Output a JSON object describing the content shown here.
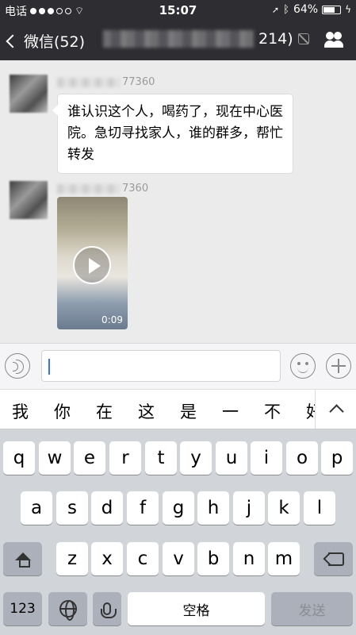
{
  "status_bar": {
    "carrier": "电话",
    "time": "15:07",
    "battery_percent": "64%"
  },
  "nav": {
    "back_label": "微信(52)",
    "title_suffix": "214)"
  },
  "messages": [
    {
      "sender_suffix": "77360",
      "text": "谁认识这个人，喝药了，现在中心医院。急切寻找家人，谁的群多，帮忙转发"
    },
    {
      "sender_suffix": "7360",
      "video_duration": "0:09"
    }
  ],
  "candidates": [
    "我",
    "你",
    "在",
    "这",
    "是",
    "一",
    "不",
    "好"
  ],
  "keyboard": {
    "row1": [
      "q",
      "w",
      "e",
      "r",
      "t",
      "y",
      "u",
      "i",
      "o",
      "p"
    ],
    "row2": [
      "a",
      "s",
      "d",
      "f",
      "g",
      "h",
      "j",
      "k",
      "l"
    ],
    "row3": [
      "z",
      "x",
      "c",
      "v",
      "b",
      "n",
      "m"
    ],
    "numbers_label": "123",
    "space_label": "空格",
    "send_label": "发送"
  },
  "colors": {
    "header_bg": "#2e2e32",
    "chat_bg": "#ebebeb",
    "keyboard_bg": "#d1d4d9"
  }
}
